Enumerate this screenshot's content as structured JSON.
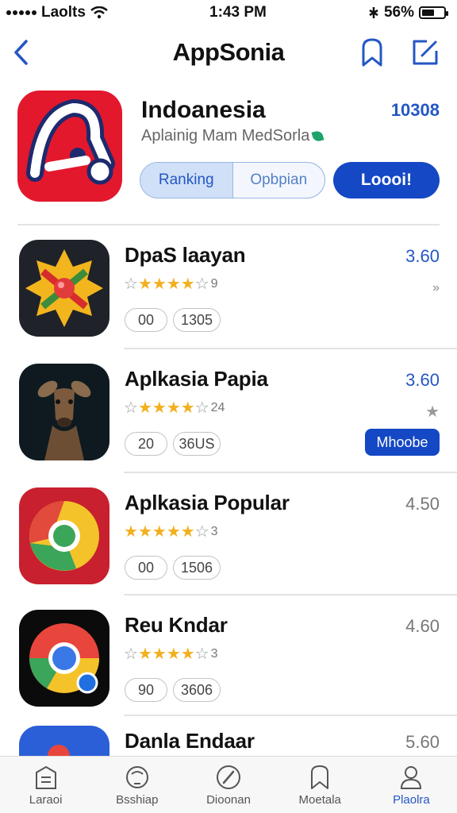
{
  "status_bar": {
    "carrier": "Laolts",
    "time": "1:43 PM",
    "battery": "56%",
    "battery_level": 0.56
  },
  "nav": {
    "title": "AppSonia"
  },
  "hero": {
    "title": "Indoanesia",
    "count": "10308",
    "subtitle": "Aplainig Mam MedSorla",
    "segments": [
      "Ranking",
      "Opbpian"
    ],
    "primary_button": "Loooi!"
  },
  "apps": [
    {
      "name": "DpaS laayan",
      "score": "3.60",
      "stars": 4,
      "rating_count": "9",
      "pills": [
        "00",
        "1305"
      ],
      "accessory": "chevron"
    },
    {
      "name": "Aplkasia Papia",
      "score": "3.60",
      "stars": 4,
      "rating_count": "24",
      "pills": [
        "20",
        "36US"
      ],
      "accessory": "star",
      "button": "Mhoobe"
    },
    {
      "name": "Aplkasia Popular",
      "score": "4.50",
      "stars": 4,
      "rating_count": "3",
      "pills": [
        "00",
        "1506"
      ],
      "accessory": "none"
    },
    {
      "name": "Reu Kndar",
      "score": "4.60",
      "stars": 4,
      "rating_count": "3",
      "pills": [
        "90",
        "3606"
      ],
      "accessory": "none"
    },
    {
      "name": "Danla Endaar",
      "score": "5.60",
      "accessory": "none"
    }
  ],
  "tabs": [
    {
      "label": "Laraoi",
      "icon": "building-icon"
    },
    {
      "label": "Bsshiap",
      "icon": "face-icon"
    },
    {
      "label": "Dioonan",
      "icon": "compass-icon"
    },
    {
      "label": "Moetala",
      "icon": "bookmark-icon"
    },
    {
      "label": "Plaolra",
      "icon": "person-icon",
      "active": true
    }
  ],
  "colors": {
    "accent": "#1448c4",
    "link": "#2457c4",
    "star": "#f2b01e",
    "hero_icon_bg": "#e3182d"
  }
}
